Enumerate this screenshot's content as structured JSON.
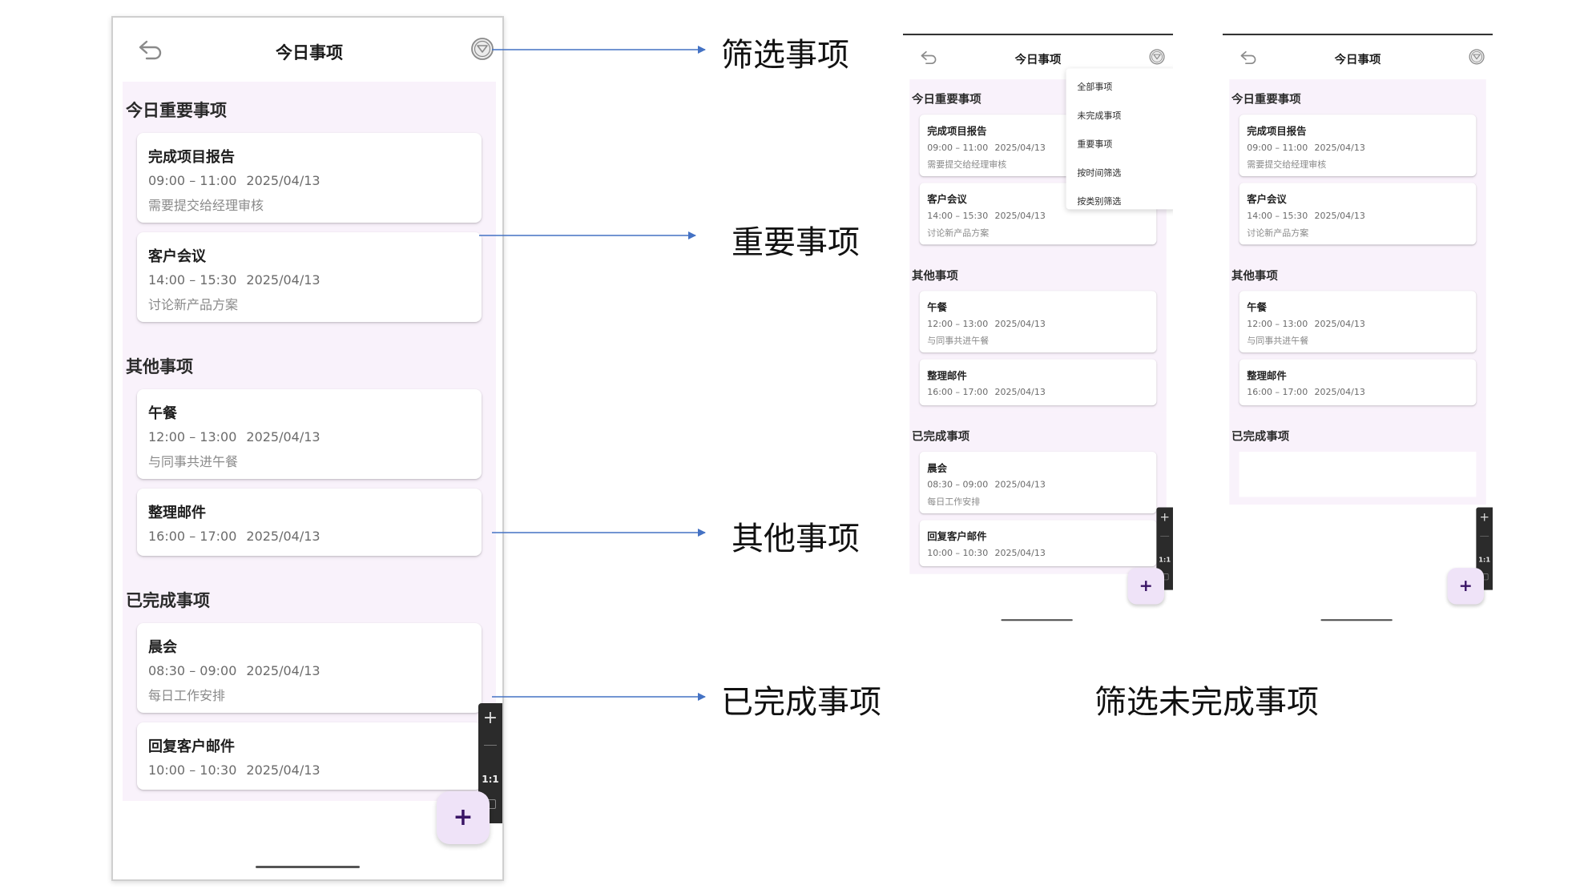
{
  "screen": {
    "title": "今日事项",
    "sections": [
      {
        "title": "今日重要事项",
        "items": [
          {
            "title": "完成项目报告",
            "time": "09:00 – 11:00",
            "date": "2025/04/13",
            "desc": "需要提交给经理审核"
          },
          {
            "title": "客户会议",
            "time": "14:00 – 15:30",
            "date": "2025/04/13",
            "desc": "讨论新产品方案"
          }
        ]
      },
      {
        "title": "其他事项",
        "items": [
          {
            "title": "午餐",
            "time": "12:00 – 13:00",
            "date": "2025/04/13",
            "desc": "与同事共进午餐"
          },
          {
            "title": "整理邮件",
            "time": "16:00 – 17:00",
            "date": "2025/04/13",
            "desc": ""
          }
        ]
      },
      {
        "title": "已完成事项",
        "items": [
          {
            "title": "晨会",
            "time": "08:30 – 09:00",
            "date": "2025/04/13",
            "desc": "每日工作安排"
          },
          {
            "title": "回复客户邮件",
            "time": "10:00 – 10:30",
            "date": "2025/04/13",
            "desc": ""
          }
        ]
      }
    ],
    "fab_label": "+",
    "zoom": {
      "plus": "+",
      "ratio": "1:1"
    }
  },
  "filter_menu": {
    "items": [
      "全部事项",
      "未完成事项",
      "重要事项",
      "按时间筛选",
      "按类别筛选"
    ]
  },
  "annotations": {
    "filter": "筛选事项",
    "important": "重要事项",
    "other": "其他事项",
    "completed": "已完成事项",
    "filter_incomplete": "筛选未完成事项"
  },
  "colors": {
    "accent": "#3a1566",
    "section_bg": "#f9f2fb",
    "fab_bg": "#efe3f8",
    "arrow": "#4472c4"
  }
}
